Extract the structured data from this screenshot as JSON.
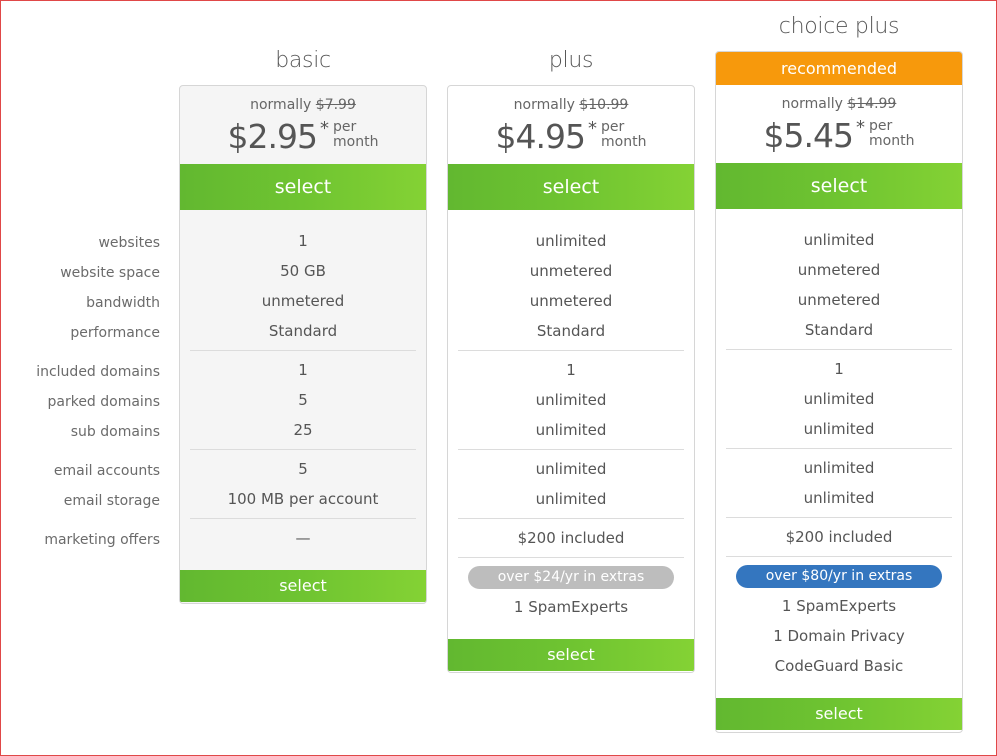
{
  "feature_labels": [
    "websites",
    "website space",
    "bandwidth",
    "performance",
    "included domains",
    "parked domains",
    "sub domains",
    "email accounts",
    "email storage",
    "marketing offers"
  ],
  "colors": {
    "accent_green": "#6fc431",
    "recommended_orange": "#f7990c",
    "extras_blue": "#3476bf",
    "extras_gray": "#bdbdbd",
    "frame_red": "#e04848"
  },
  "plans": [
    {
      "name": "basic",
      "normally_label": "normally",
      "old_price": "$7.99",
      "price": "$2.95",
      "asterisk": "*",
      "per": "per",
      "period": "month",
      "select_label": "select",
      "features": [
        "1",
        "50 GB",
        "unmetered",
        "Standard",
        "1",
        "5",
        "25",
        "5",
        "100 MB per account",
        "—"
      ],
      "extras_badge": null,
      "extras": [],
      "bottom_select_label": "select"
    },
    {
      "name": "plus",
      "normally_label": "normally",
      "old_price": "$10.99",
      "price": "$4.95",
      "asterisk": "*",
      "per": "per",
      "period": "month",
      "select_label": "select",
      "features": [
        "unlimited",
        "unmetered",
        "unmetered",
        "Standard",
        "1",
        "unlimited",
        "unlimited",
        "unlimited",
        "unlimited",
        "$200 included"
      ],
      "extras_badge": "over $24/yr in extras",
      "extras": [
        "1 SpamExperts"
      ],
      "bottom_select_label": "select"
    },
    {
      "name": "choice plus",
      "badge": "recommended",
      "normally_label": "normally",
      "old_price": "$14.99",
      "price": "$5.45",
      "asterisk": "*",
      "per": "per",
      "period": "month",
      "select_label": "select",
      "features": [
        "unlimited",
        "unmetered",
        "unmetered",
        "Standard",
        "1",
        "unlimited",
        "unlimited",
        "unlimited",
        "unlimited",
        "$200 included"
      ],
      "extras_badge": "over $80/yr in extras",
      "extras": [
        "1 SpamExperts",
        "1 Domain Privacy",
        "CodeGuard Basic"
      ],
      "bottom_select_label": "select"
    }
  ]
}
